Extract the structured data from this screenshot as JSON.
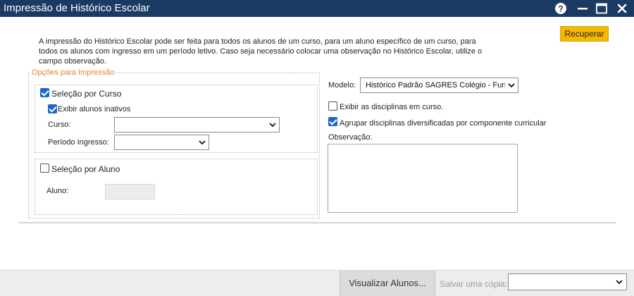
{
  "window": {
    "title": "Impressão de Histórico Escolar",
    "controls": [
      "help-icon",
      "minimize-icon",
      "maximize-icon",
      "close-icon"
    ]
  },
  "intro_text": "A impressão do Histórico Escolar pode ser feita para todos os alunos de um curso, para um aluno específico de um curso, para todos os alunos com ingresso em um período letivo. Caso seja necessário colocar uma observação no Histórico Escolar, utilize o campo observação.",
  "actions": {
    "recuperar_label": "Recuperar"
  },
  "options": {
    "legend": "Opções para Impressão",
    "selecao_curso": {
      "label": "Seleção por Curso",
      "checked": true
    },
    "exibir_inativos": {
      "label": "Exibir alunos inativos",
      "checked": true
    },
    "curso": {
      "label": "Curso:",
      "value": ""
    },
    "periodo": {
      "label": "Período Ingresso:",
      "value": ""
    },
    "selecao_aluno": {
      "label": "Seleção por Aluno",
      "checked": false
    },
    "aluno": {
      "label": "Aluno:",
      "value": ""
    }
  },
  "right": {
    "modelo": {
      "label": "Modelo:",
      "value": "Histórico Padrão SAGRES Colégio - Fundamental"
    },
    "exibir_em_curso": {
      "label": "Exibir as disciplinas em curso.",
      "checked": false
    },
    "agrupar": {
      "label": "Agrupar disciplinas diversificadas por componente curricular",
      "checked": true
    },
    "observacao": {
      "label": "Observação:",
      "value": ""
    }
  },
  "footer": {
    "visualizar_label": "Visualizar Alunos...",
    "salvar_label": "Salvar uma cópia:",
    "salvar_value": ""
  },
  "colors": {
    "titlebar": "#1b3a63",
    "accent_button": "#f5b800",
    "legend": "#e8822a",
    "checkbox": "#1e66c9"
  }
}
